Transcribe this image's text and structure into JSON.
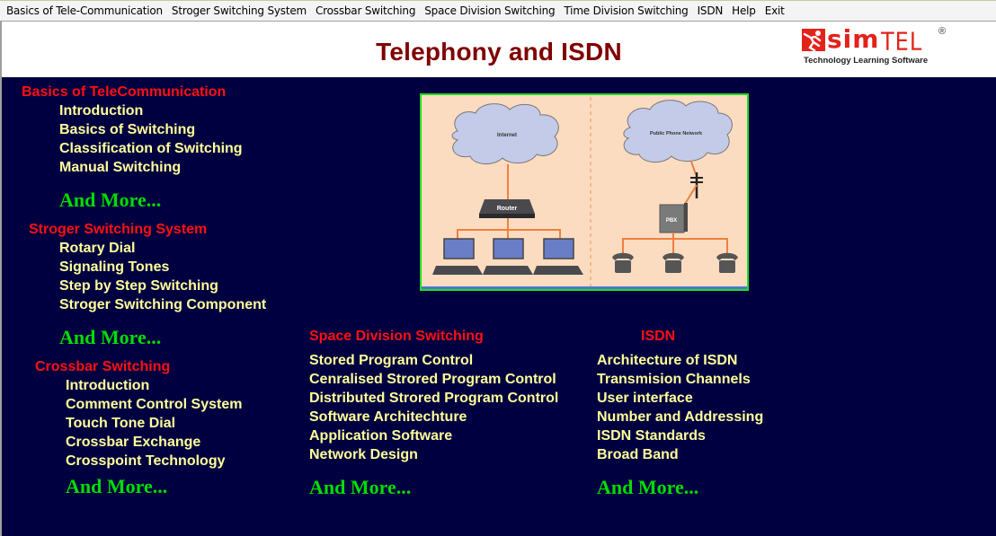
{
  "menubar": {
    "items": [
      "Basics of Tele-Communication",
      "Stroger Switching System",
      "Crossbar Switching",
      "Space Division Switching",
      "Time Division Switching",
      "ISDN",
      "Help",
      "Exit"
    ]
  },
  "header": {
    "title": "Telephony and ISDN",
    "logo": {
      "brand_bold": "sim",
      "brand_light": "TEL",
      "registered": "®",
      "tagline": "Technology Learning  Software",
      "icon": "running-figure-icon"
    }
  },
  "colors": {
    "background": "#000040",
    "section_title": "#ff1010",
    "item": "#ffff99",
    "more": "#00dd00",
    "title": "#800000",
    "brand": "#e3221b"
  },
  "sections": {
    "basics": {
      "title": "Basics of TeleCommunication",
      "items": [
        "Introduction",
        "Basics of Switching",
        "Classification of Switching",
        "Manual Switching"
      ],
      "more": "And More..."
    },
    "stroger": {
      "title": "Stroger Switching System",
      "items": [
        "Rotary Dial",
        "Signaling Tones",
        "Step by Step Switching",
        "Stroger Switching Component"
      ],
      "more": "And More..."
    },
    "crossbar": {
      "title": "Crossbar Switching",
      "items": [
        "Introduction",
        "Comment Control System",
        "Touch Tone Dial",
        "Crossbar Exchange",
        "Crosspoint Technology"
      ],
      "more": "And More..."
    },
    "space_division": {
      "title": "Space Division Switching",
      "items": [
        "Stored Program Control",
        "Cenralised Strored Program Control",
        "Distributed Strored Program Control",
        "Software Architechture",
        "Application Software",
        "Network Design"
      ],
      "more": "And More..."
    },
    "isdn": {
      "title": "ISDN",
      "items": [
        "Architecture of ISDN",
        "Transmision Channels",
        "User interface",
        "Number and Addressing",
        "ISDN Standards",
        "Broad Band"
      ],
      "more": "And More..."
    }
  },
  "diagram": {
    "left_cloud": "Internet",
    "right_cloud": "Public Phone Network",
    "router": "Router",
    "pbx": "PBX"
  }
}
